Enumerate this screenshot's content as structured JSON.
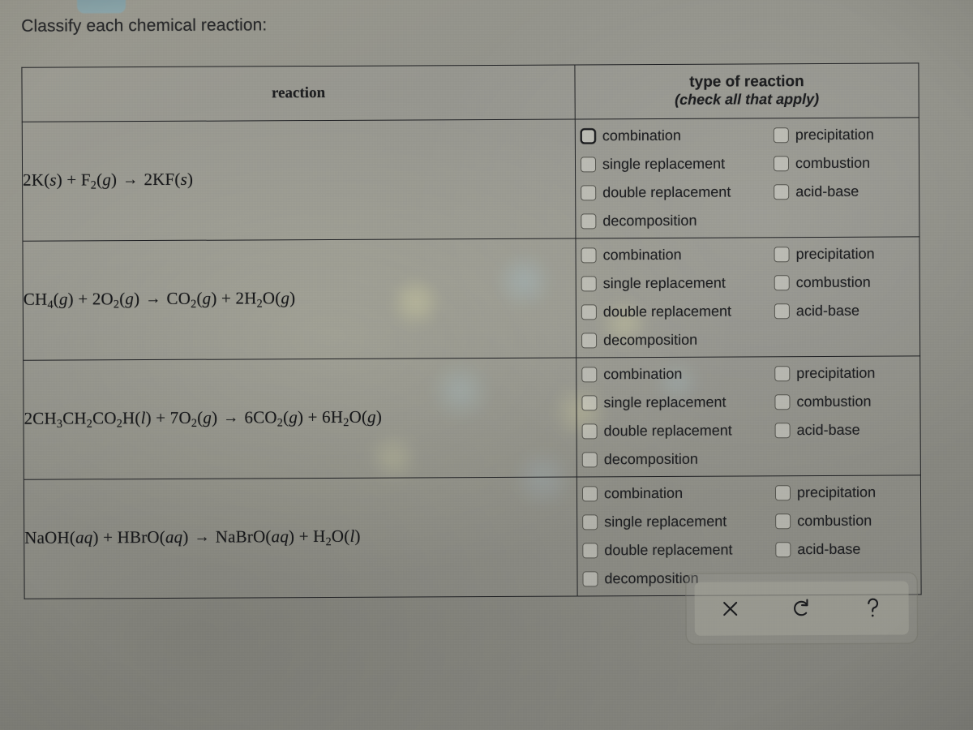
{
  "prompt": "Classify each chemical reaction:",
  "table": {
    "headers": {
      "reaction": "reaction",
      "type_main": "type of reaction",
      "type_sub": "(check all that apply)"
    },
    "rows": [
      {
        "equation_plain": "2K(s) + F2(g) → 2KF(s)",
        "options": [
          {
            "label": "combination",
            "checked": false,
            "focused": true
          },
          {
            "label": "precipitation",
            "checked": false,
            "focused": false
          },
          {
            "label": "single replacement",
            "checked": false,
            "focused": false
          },
          {
            "label": "combustion",
            "checked": false,
            "focused": false
          },
          {
            "label": "double replacement",
            "checked": false,
            "focused": false
          },
          {
            "label": "acid-base",
            "checked": false,
            "focused": false
          },
          {
            "label": "decomposition",
            "checked": false,
            "focused": false
          }
        ]
      },
      {
        "equation_plain": "CH4(g) + 2O2(g) → CO2(g) + 2H2O(g)",
        "options": [
          {
            "label": "combination",
            "checked": false,
            "focused": false
          },
          {
            "label": "precipitation",
            "checked": false,
            "focused": false
          },
          {
            "label": "single replacement",
            "checked": false,
            "focused": false
          },
          {
            "label": "combustion",
            "checked": false,
            "focused": false
          },
          {
            "label": "double replacement",
            "checked": false,
            "focused": false
          },
          {
            "label": "acid-base",
            "checked": false,
            "focused": false
          },
          {
            "label": "decomposition",
            "checked": false,
            "focused": false
          }
        ]
      },
      {
        "equation_plain": "2CH3CH2CO2H(l) + 7O2(g) → 6CO2(g) + 6H2O(g)",
        "options": [
          {
            "label": "combination",
            "checked": false,
            "focused": false
          },
          {
            "label": "precipitation",
            "checked": false,
            "focused": false
          },
          {
            "label": "single replacement",
            "checked": false,
            "focused": false
          },
          {
            "label": "combustion",
            "checked": false,
            "focused": false
          },
          {
            "label": "double replacement",
            "checked": false,
            "focused": false
          },
          {
            "label": "acid-base",
            "checked": false,
            "focused": false
          },
          {
            "label": "decomposition",
            "checked": false,
            "focused": false
          }
        ]
      },
      {
        "equation_plain": "NaOH(aq) + HBrO(aq) → NaBrO(aq) + H2O(l)",
        "options": [
          {
            "label": "combination",
            "checked": false,
            "focused": false
          },
          {
            "label": "precipitation",
            "checked": false,
            "focused": false
          },
          {
            "label": "single replacement",
            "checked": false,
            "focused": false
          },
          {
            "label": "combustion",
            "checked": false,
            "focused": false
          },
          {
            "label": "double replacement",
            "checked": false,
            "focused": false
          },
          {
            "label": "acid-base",
            "checked": false,
            "focused": false
          },
          {
            "label": "decomposition",
            "checked": false,
            "focused": false
          }
        ]
      }
    ]
  },
  "toolbar": {
    "buttons": [
      {
        "name": "clear-button",
        "icon": "x-icon",
        "glyph": "×"
      },
      {
        "name": "reset-button",
        "icon": "undo-arrow-icon",
        "glyph": "↺"
      },
      {
        "name": "help-button",
        "icon": "question-mark-icon",
        "glyph": "?"
      }
    ]
  },
  "colors": {
    "text": "#1d1e21",
    "border": "#1f2023",
    "background": "#8e8e86",
    "focus_outline": "#16171a"
  }
}
